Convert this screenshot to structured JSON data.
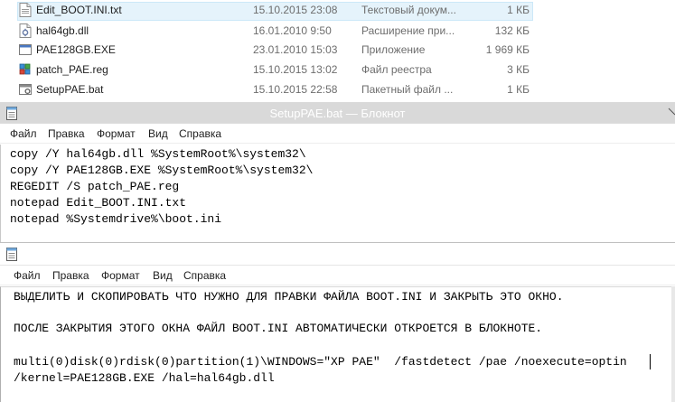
{
  "files": [
    {
      "name": "Edit_BOOT.INI.txt",
      "date": "15.10.2015 23:08",
      "type": "Текстовый докум...",
      "size": "1 КБ",
      "icon": "text-file-icon",
      "selected": true
    },
    {
      "name": "hal64gb.dll",
      "date": "16.01.2010 9:50",
      "type": "Расширение при...",
      "size": "132 КБ",
      "icon": "dll-file-icon",
      "selected": false
    },
    {
      "name": "PAE128GB.EXE",
      "date": "23.01.2010 15:03",
      "type": "Приложение",
      "size": "1 969 КБ",
      "icon": "exe-file-icon",
      "selected": false
    },
    {
      "name": "patch_PAE.reg",
      "date": "15.10.2015 13:02",
      "type": "Файл реестра",
      "size": "3 КБ",
      "icon": "reg-file-icon",
      "selected": false
    },
    {
      "name": "SetupPAE.bat",
      "date": "15.10.2015 22:58",
      "type": "Пакетный файл ...",
      "size": "1 КБ",
      "icon": "bat-file-icon",
      "selected": false
    }
  ],
  "notepad1": {
    "title": "SetupPAE.bat — Блокнот",
    "menu": [
      "Файл",
      "Правка",
      "Формат",
      "Вид",
      "Справка"
    ],
    "lines": [
      "copy /Y hal64gb.dll %SystemRoot%\\system32\\",
      "copy /Y PAE128GB.EXE %SystemRoot%\\system32\\",
      "REGEDIT /S patch_PAE.reg",
      "notepad Edit_BOOT.INI.txt",
      "notepad %Systemdrive%\\boot.ini"
    ]
  },
  "notepad2": {
    "menu": [
      "Файл",
      "Правка",
      "Формат",
      "Вид",
      "Справка"
    ],
    "lines": [
      "ВЫДЕЛИТЬ И СКОПИРОВАТЬ ЧТО НУЖНО ДЛЯ ПРАВКИ ФАЙЛА BOOT.INI И ЗАКРЫТЬ ЭТО ОКНО.",
      "",
      "ПОСЛЕ ЗАКРЫТИЯ ЭТОГО ОКНА ФАЙЛ BOOT.INI АВТОМАТИЧЕСКИ ОТКРОЕТСЯ В БЛОКНОТЕ.",
      "",
      "multi(0)disk(0)rdisk(0)partition(1)\\WINDOWS=\"XP PAE\"  /fastdetect /pae /noexecute=optin",
      "/kernel=PAE128GB.EXE /hal=hal64gb.dll"
    ]
  },
  "colors": {
    "selection": "#e5f3fb",
    "inactive_title": "#d9d9d9",
    "meta_text": "#6d6d6d"
  }
}
